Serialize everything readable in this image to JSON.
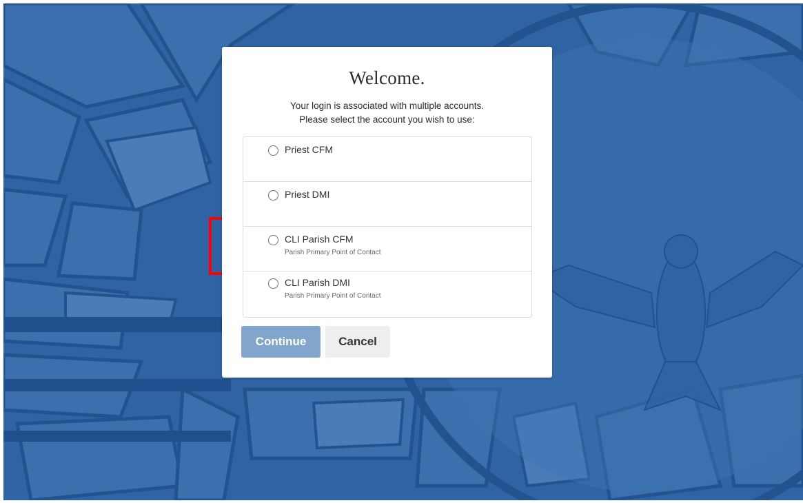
{
  "colors": {
    "background": "#2f63a4",
    "continue_button": "#82a5cc",
    "cancel_button": "#eeeeee",
    "highlight": "#ff0000"
  },
  "dialog": {
    "title": "Welcome.",
    "subtitle_line1": "Your login is associated with multiple accounts.",
    "subtitle_line2": "Please select the account you wish to use:",
    "accounts": [
      {
        "label": "Priest CFM",
        "role": "",
        "selected": false
      },
      {
        "label": "Priest DMI",
        "role": "",
        "selected": false
      },
      {
        "label": "CLI Parish CFM",
        "role": "Parish Primary Point of Contact",
        "selected": false
      },
      {
        "label": "CLI Parish DMI",
        "role": "Parish Primary Point of Contact",
        "selected": false
      }
    ],
    "continue_label": "Continue",
    "cancel_label": "Cancel"
  }
}
